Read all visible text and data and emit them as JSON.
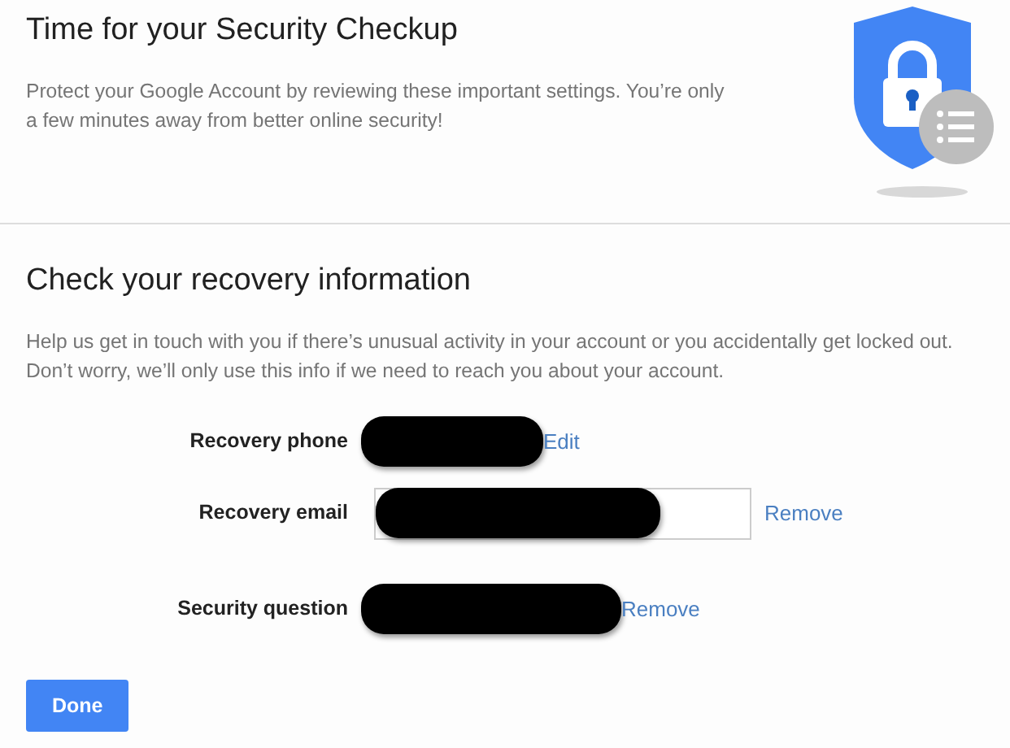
{
  "header": {
    "title": "Time for your Security Checkup",
    "description": "Protect your Google Account by reviewing these important settings. You’re only a few minutes away from better online security!"
  },
  "section": {
    "title": "Check your recovery information",
    "description": "Help us get in touch with you if there’s unusual activity in your account or you accidentally get locked out. Don’t worry, we’ll only use this info if we need to reach you about your account."
  },
  "rows": [
    {
      "label": "Recovery phone",
      "kind": "plain",
      "action": "Edit"
    },
    {
      "label": "Recovery email",
      "kind": "field",
      "action": "Remove"
    },
    {
      "label": "Security question",
      "kind": "plain",
      "action": "Remove"
    }
  ],
  "buttons": [
    {
      "label": "Done"
    }
  ]
}
